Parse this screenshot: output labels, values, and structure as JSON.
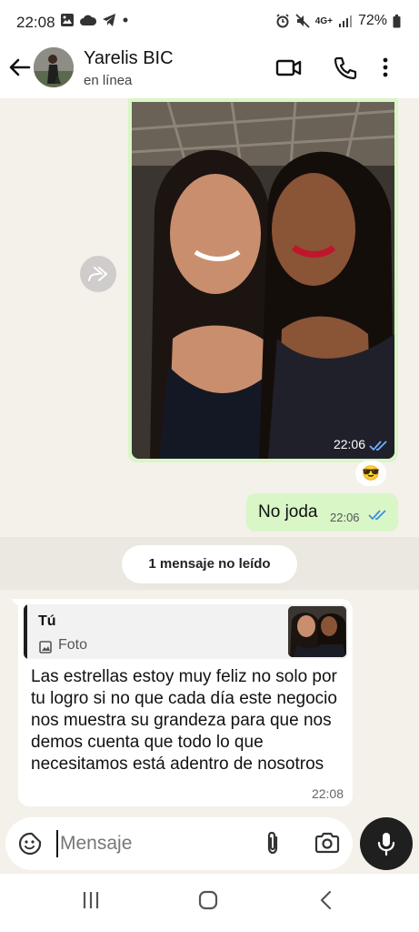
{
  "status_bar": {
    "time": "22:08",
    "network": "4G+",
    "battery": "72%",
    "icons": [
      "image-icon",
      "cloud-icon",
      "telegram-icon",
      "dot-icon",
      "alarm-icon",
      "mute-icon",
      "signal-icon",
      "battery-icon"
    ]
  },
  "header": {
    "contact_name": "Yarelis BIC",
    "contact_status": "en línea",
    "icons": [
      "back-arrow-icon",
      "avatar",
      "video-call-icon",
      "phone-icon",
      "more-vert-icon"
    ]
  },
  "messages": {
    "photo": {
      "time": "22:06",
      "read": true,
      "reaction": "😎"
    },
    "outgoing_text": {
      "text": "No joda",
      "time": "22:06",
      "read": true
    },
    "unread_banner": "1 mensaje no leído",
    "incoming": {
      "quote_author": "Tú",
      "quote_type": "Foto",
      "text": "Las estrellas estoy muy feliz no solo por tu logro si no que cada día este negocio nos muestra su grandeza para que nos demos cuenta que todo lo que necesitamos está adentro de nosotros",
      "time": "22:08"
    }
  },
  "composer": {
    "placeholder": "Mensaje",
    "value": ""
  },
  "colors": {
    "outgoing_bubble": "#d8f6c6",
    "chat_background": "#f4f0ea",
    "read_ticks": "#3a8de0",
    "mic_button": "#1f1f1f"
  }
}
